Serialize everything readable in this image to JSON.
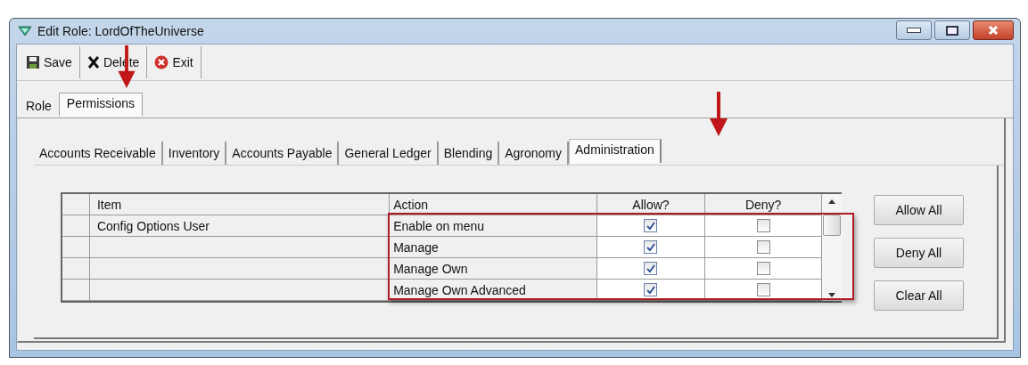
{
  "window": {
    "title": "Edit Role: LordOfTheUniverse"
  },
  "toolbar": [
    {
      "label": "Save",
      "kind": "save"
    },
    {
      "label": "Delete",
      "kind": "delete"
    },
    {
      "label": "Exit",
      "kind": "exit"
    }
  ],
  "tabs": [
    {
      "label": "Role",
      "selected": false
    },
    {
      "label": "Permissions",
      "selected": true
    }
  ],
  "module_tabs": [
    {
      "label": "Accounts Receivable",
      "selected": false
    },
    {
      "label": "Inventory",
      "selected": false
    },
    {
      "label": "Accounts Payable",
      "selected": false
    },
    {
      "label": "General Ledger",
      "selected": false
    },
    {
      "label": "Blending",
      "selected": false
    },
    {
      "label": "Agronomy",
      "selected": false
    },
    {
      "label": "Administration",
      "selected": true
    }
  ],
  "table": {
    "columns": [
      "Item",
      "Action",
      "Allow?",
      "Deny?"
    ],
    "rows": [
      {
        "item": "Config Options User",
        "action": "Enable on menu",
        "allow": true,
        "deny": false
      },
      {
        "action": "Manage",
        "allow": true,
        "deny": false
      },
      {
        "action": "Manage Own",
        "allow": true,
        "deny": false
      },
      {
        "action": "Manage Own Advanced",
        "allow": true,
        "deny": false
      }
    ]
  },
  "buttons": [
    "Allow All",
    "Deny All",
    "Clear All"
  ]
}
